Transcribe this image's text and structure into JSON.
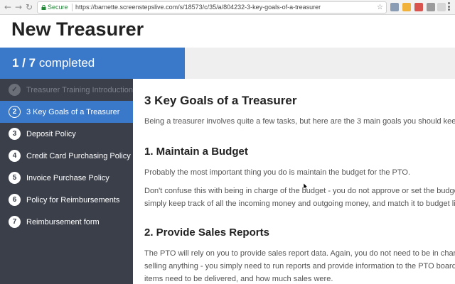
{
  "browser": {
    "secure_label": "Secure",
    "url": "https://barnette.screenstepslive.com/s/18573/c/35/a/804232-3-key-goals-of-a-treasurer"
  },
  "page": {
    "title": "New Treasurer"
  },
  "progress": {
    "fraction": "1 / 7",
    "label": "completed",
    "percent": 40.6
  },
  "sidebar": {
    "items": [
      {
        "number": "✓",
        "label": "Treasurer Training Introduction",
        "state": "done"
      },
      {
        "number": "2",
        "label": "3 Key Goals of a Treasurer",
        "state": "active"
      },
      {
        "number": "3",
        "label": "Deposit Policy",
        "state": "todo"
      },
      {
        "number": "4",
        "label": "Credit Card Purchasing Policy",
        "state": "todo"
      },
      {
        "number": "5",
        "label": "Invoice Purchase Policy",
        "state": "todo"
      },
      {
        "number": "6",
        "label": "Policy for Reimbursements",
        "state": "todo"
      },
      {
        "number": "7",
        "label": "Reimbursement form",
        "state": "todo"
      }
    ]
  },
  "article": {
    "title": "3 Key Goals of a Treasurer",
    "intro": "Being a treasurer involves quite a few tasks, but here are the 3 main goals you should keep in m",
    "sections": [
      {
        "heading": "1. Maintain a Budget",
        "paragraphs": [
          "Probably the most important thing you do is maintain the budget for the PTO.",
          "Don't confuse this with being in charge of the budget - you do not approve or set the budget. Y",
          "simply keep track of all the incoming money and outgoing money, and match it to budget line i"
        ]
      },
      {
        "heading": "2. Provide Sales Reports",
        "paragraphs": [
          "The PTO will rely on you to provide sales report data. Again, you do not need to be in charge o",
          "selling anything - you simply need to run reports and provide information to the PTO board on",
          "items need to be delivered, and how much sales were."
        ]
      }
    ]
  }
}
